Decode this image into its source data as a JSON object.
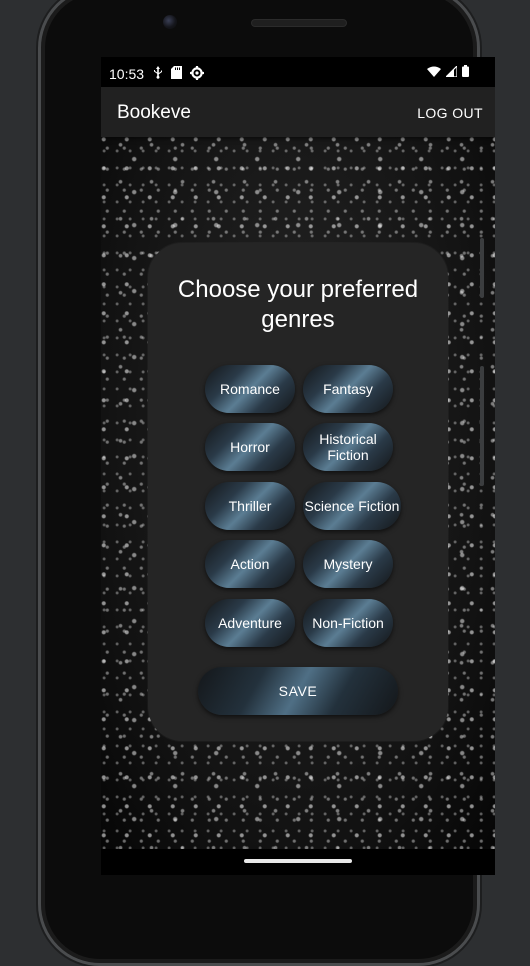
{
  "status_bar": {
    "time": "10:53",
    "left_icons": [
      "usb-debug-icon",
      "sd-card-icon",
      "settings-gear-icon"
    ],
    "right_icons": [
      "wifi-icon",
      "signal-icon",
      "battery-icon"
    ]
  },
  "app_bar": {
    "title": "Bookeve",
    "logout_label": "LOG OUT"
  },
  "genre_card": {
    "title": "Choose your preferred genres",
    "genres": [
      "Romance",
      "Fantasy",
      "Horror",
      "Historical Fiction",
      "Thriller",
      "Science Fiction",
      "Action",
      "Mystery",
      "Adventure",
      "Non-Fiction"
    ],
    "save_label": "SAVE"
  },
  "colors": {
    "app_bar": "#212121",
    "card": "#252525",
    "chip_highlight": "#5b7d93",
    "text": "#ffffff"
  }
}
